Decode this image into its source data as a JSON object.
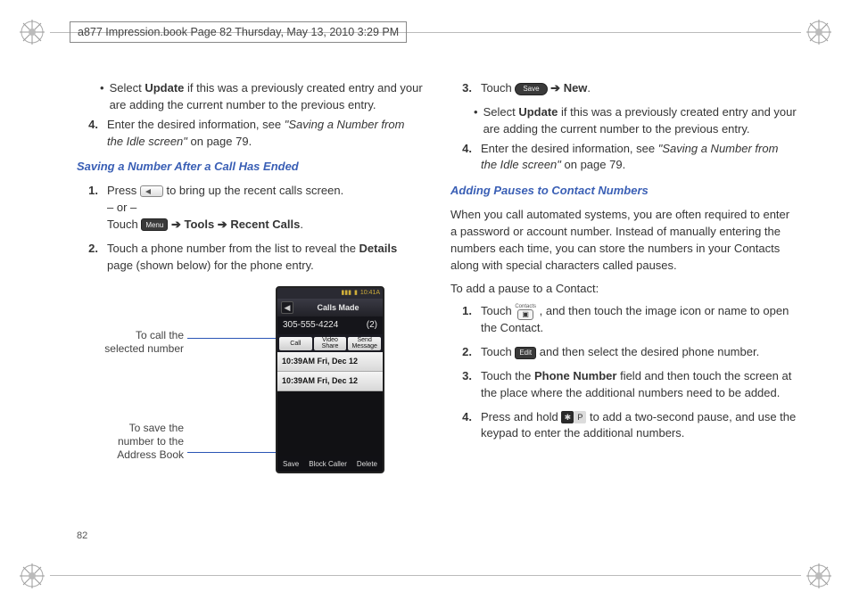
{
  "crop_header": "a877 Impression.book  Page 82  Thursday, May 13, 2010  3:29 PM",
  "page_number": "82",
  "left": {
    "bullet1_a": "Select ",
    "bullet1_b": "Update",
    "bullet1_c": " if this was a previously created entry and your are adding the current number to the previous entry.",
    "item4_num": "4.",
    "item4_a": "Enter the desired information, see ",
    "item4_b": "\"Saving a Number from the Idle screen\"",
    "item4_c": " on page 79.",
    "subhead": "Saving a Number After a Call Has Ended",
    "s1_num": "1.",
    "s1_a": "Press ",
    "s1_b": " to bring up the recent calls screen.",
    "s1_or": "– or –",
    "s1_c": "Touch ",
    "s1_d": "Tools",
    "s1_e": "Recent Calls",
    "s2_num": "2.",
    "s2_a": "Touch a phone number from the list to reveal the ",
    "s2_b": "Details",
    "s2_c": " page (shown below) for the phone entry.",
    "callout1_l1": "To call the",
    "callout1_l2": "selected number",
    "callout2_l1": "To save the",
    "callout2_l2": "number to the",
    "callout2_l3": "Address Book"
  },
  "phone": {
    "clock": "10:41A",
    "title": "Calls Made",
    "number": "305-555-4224",
    "count": "(2)",
    "btn_call": "Call",
    "btn_video": "Video Share",
    "btn_send": "Send Message",
    "entry": "10:39AM Fri, Dec 12",
    "soft_l": "Save",
    "soft_m": "Block Caller",
    "soft_r": "Delete"
  },
  "right": {
    "r3_num": "3.",
    "r3_a": "Touch ",
    "r3_save": "Save",
    "r3_b": "New",
    "bullet_a": "Select ",
    "bullet_b": "Update",
    "bullet_c": " if this was a previously created entry and your are adding the current number to the previous entry.",
    "r4_num": "4.",
    "r4_a": "Enter the desired information, see ",
    "r4_b": "\"Saving a Number from the Idle screen\"",
    "r4_c": " on page 79.",
    "subhead": "Adding Pauses to Contact Numbers",
    "para": "When you call automated systems, you are often required to enter a password or account number. Instead of manually entering the numbers each time, you can store the numbers in your Contacts along with special characters called pauses.",
    "lead": "To add a pause to a Contact:",
    "p1_num": "1.",
    "p1_a": "Touch ",
    "p1_b": ", and then touch the image icon or name to open the Contact.",
    "p2_num": "2.",
    "p2_a": "Touch ",
    "p2_edit": "Edit",
    "p2_b": " and then select the desired phone number.",
    "p3_num": "3.",
    "p3_a": "Touch the ",
    "p3_b": "Phone Number",
    "p3_c": " field and then touch the screen at the place where the additional numbers need to be added.",
    "p4_num": "4.",
    "p4_a": "Press and hold ",
    "p4_b": " to add a two-second pause, and use the keypad to enter the additional numbers."
  },
  "icons": {
    "menu": "Menu",
    "contacts_top": "Contacts"
  }
}
